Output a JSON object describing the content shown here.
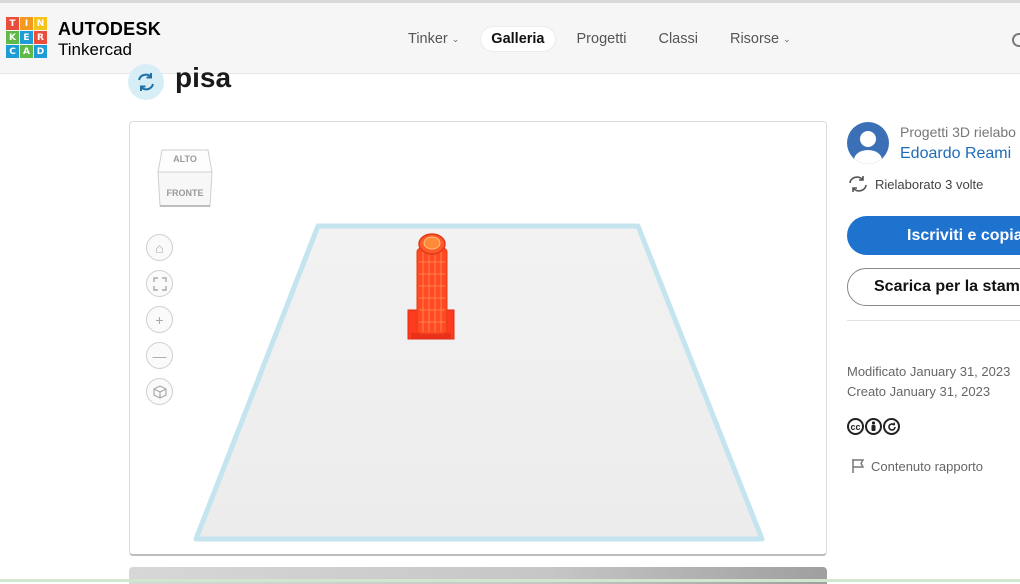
{
  "header": {
    "logo": {
      "letters": [
        "T",
        "I",
        "N",
        "K",
        "E",
        "R",
        "C",
        "A",
        "D"
      ],
      "colors": [
        "#e94e3c",
        "#f39a1e",
        "#f7c21a",
        "#5fb947",
        "#1f9cd6",
        "#e94e3c",
        "#1f9cd6",
        "#5fb947",
        "#1f9cd6"
      ]
    },
    "brand_name": "AUTODESK",
    "product_name": "Tinkercad",
    "nav": [
      {
        "label": "Tinker",
        "has_dropdown": true,
        "active": false
      },
      {
        "label": "Galleria",
        "has_dropdown": false,
        "active": true
      },
      {
        "label": "Progetti",
        "has_dropdown": false,
        "active": false
      },
      {
        "label": "Classi",
        "has_dropdown": false,
        "active": false
      },
      {
        "label": "Risorse",
        "has_dropdown": true,
        "active": false
      }
    ]
  },
  "design": {
    "title": "pisa",
    "title_icon": "remix-icon"
  },
  "viewer": {
    "viewcube": {
      "top_label": "ALTO",
      "front_label": "FRONTE"
    },
    "controls": [
      "home-icon",
      "fit-view-icon",
      "zoom-in-icon",
      "zoom-out-icon",
      "perspective-icon"
    ],
    "model_color": "#ff3b1f",
    "workplane_color": "#bfe3ef"
  },
  "sidebar": {
    "caption": "Progetti 3D rielabo",
    "author": "Edoardo Reami",
    "remix_count_text": "Rielaborato 3 volte",
    "primary_button": "Iscriviti e copia",
    "secondary_button": "Scarica per la stamp",
    "modified": "Modificato January 31, 2023",
    "created": "Creato January 31, 2023",
    "license_icons": [
      "cc",
      "by",
      "sa"
    ],
    "report_label": "Contenuto rapporto"
  },
  "colors": {
    "accent": "#1e73cf",
    "author_link": "#1e6bb8"
  }
}
